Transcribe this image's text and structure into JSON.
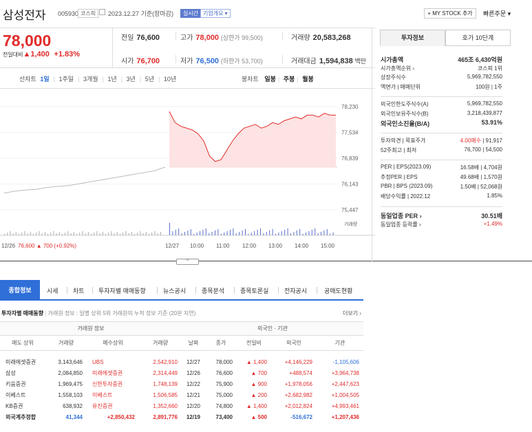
{
  "header": {
    "company": "삼성전자",
    "code": "005930",
    "market": "코스피",
    "date": "2023.12.27",
    "date_suffix": "기준(장마감)",
    "realtime": "실시간",
    "overview": "기업개요",
    "mystock": "+ MY STOCK 추가",
    "quick_order": "빠른주문"
  },
  "quote": {
    "price": "78,000",
    "change_label": "전일대비",
    "change": "▲1,400",
    "change_pct": "+1.83%",
    "prev_close_label": "전일",
    "prev_close": "76,600",
    "high_label": "고가",
    "high": "78,000",
    "upper_limit": "(상한가 99,500)",
    "volume_label": "거래량",
    "volume": "20,583,268",
    "open_label": "시가",
    "open": "76,700",
    "low_label": "저가",
    "low": "76,500",
    "lower_limit": "(하한가 53,700)",
    "amount_label": "거래대금",
    "amount": "1,594,838",
    "amount_unit": "백만"
  },
  "period_tabs": [
    "선차트",
    "1일",
    "1주일",
    "3개월",
    "1년",
    "3년",
    "5년",
    "10년"
  ],
  "period_active": "1일",
  "candle_tabs": [
    "봉차트",
    "일봉",
    "주봉",
    "월봉"
  ],
  "chart_data": {
    "type": "line",
    "y_ticks": [
      "78,230",
      "77,534",
      "76,839",
      "76,143",
      "75,447"
    ],
    "ylim": [
      75447,
      78230
    ],
    "x_ticks": [
      "12/27",
      "10:00",
      "11:00",
      "12:00",
      "13:00",
      "14:00",
      "15:00"
    ],
    "prev_day_label": "12/26",
    "prev_day_summary": "76,600 ▲ 700 (+0.92%)",
    "volume_label": "거래량",
    "prev_day_series": [
      75900,
      75950,
      75980,
      76000,
      76050,
      76080,
      76100,
      76150,
      76200,
      76250,
      76300,
      76350,
      76400,
      76450,
      76500,
      76600
    ],
    "today_series": [
      78100,
      77800,
      77700,
      77650,
      77600,
      77500,
      77300,
      76900,
      76750,
      76800,
      77050,
      77300,
      77500,
      77650,
      77700,
      77750,
      77650,
      77700,
      77800,
      77750,
      77850,
      77900,
      77950,
      77900,
      78000,
      78000,
      77950,
      78050,
      78000,
      78000
    ]
  },
  "invest": {
    "tab_on": "투자정보",
    "tab_off": "호가 10단계",
    "rows": [
      {
        "k": "시가총액",
        "v": "465조 6,430억원",
        "bold": true
      },
      {
        "k": "시가총액순위 ›",
        "v": "코스피 1위"
      },
      {
        "k": "상장주식수",
        "v": "5,969,782,550"
      },
      {
        "k": "액면가 | 매매단위",
        "v": "100원 | 1주"
      },
      {
        "k": "외국인한도주식수(A)",
        "v": "5,969,782,550"
      },
      {
        "k": "외국인보유주식수(B)",
        "v": "3,218,439,877"
      },
      {
        "k": "외국인소진율(B/A)",
        "v": "53.91%",
        "bold": true
      },
      {
        "k": "투자의견 | 목표주가",
        "v_red": "4.00매수",
        "v": " | 91,917"
      },
      {
        "k": "52주최고 | 최저",
        "v": "76,700 | 54,500"
      },
      {
        "k": "PER | EPS(2023.09)",
        "v": "16.58배 | 4,704원"
      },
      {
        "k": "추정PER | EPS",
        "v": "49.68배 | 1,570원"
      },
      {
        "k": "PBR | BPS (2023.09)",
        "v": "1.50배 | 52,068원"
      },
      {
        "k": "배당수익률 | 2022.12",
        "v": "1.85%"
      },
      {
        "k": "동일업종 PER ›",
        "v": "30.51배",
        "bold": true
      },
      {
        "k": "동일업종 등락률 ›",
        "v": "+1.49%",
        "red": true
      }
    ]
  },
  "bottom_tabs": [
    "종합정보",
    "시세",
    "차트",
    "투자자별 매매동향",
    "뉴스공시",
    "종목분석",
    "종목토론실",
    "전자공시",
    "공매도현황"
  ],
  "trade": {
    "title": "투자자별 매매동향",
    "desc": "거래원 정보 : 일별 상위 5위 거래원의 누적 정보 기준 (20분 지연)",
    "more": "더보기 ›",
    "group_left": "거래원 정보",
    "group_right": "외국인 · 기관",
    "cols": [
      "매도 상위",
      "거래량",
      "매수상위",
      "거래량",
      "날짜",
      "종가",
      "전일비",
      "외국인",
      "기관"
    ],
    "rows": [
      [
        "미래에셋증권",
        "3,143,646",
        "UBS",
        "2,542,910",
        "12/27",
        "78,000",
        "▲ 1,400",
        "+4,146,229",
        "-1,105,606"
      ],
      [
        "삼성",
        "2,084,850",
        "미래에셋증권",
        "2,314,449",
        "12/26",
        "76,600",
        "▲ 700",
        "+488,574",
        "+3,964,738"
      ],
      [
        "키움증권",
        "1,969,475",
        "신한투자증권",
        "1,748,139",
        "12/22",
        "75,900",
        "▲ 900",
        "+1,978,056",
        "+2,447,623"
      ],
      [
        "이베스트",
        "1,558,103",
        "이베스트",
        "1,506,585",
        "12/21",
        "75,000",
        "▲ 200",
        "+2,682,982",
        "+1,004,505"
      ],
      [
        "KB증권",
        "638,932",
        "유진증권",
        "1,352,660",
        "12/20",
        "74,800",
        "▲ 1,400",
        "+2,012,824",
        "+4,993,461"
      ]
    ],
    "foot": [
      "외국계추정합",
      "41,344",
      "+2,850,432",
      "2,891,776",
      "12/19",
      "73,400",
      "▲ 500",
      "-516,672",
      "+1,207,436"
    ]
  }
}
